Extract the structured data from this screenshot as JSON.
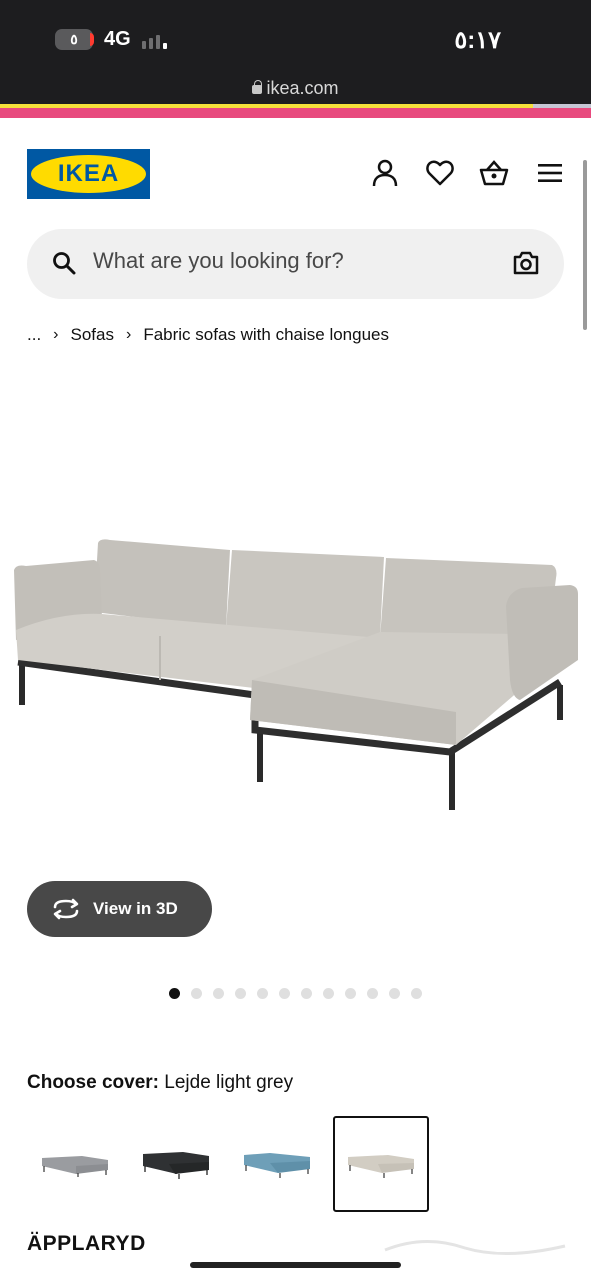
{
  "status_bar": {
    "battery_level": "٥",
    "network": "4G",
    "time": "٥:١٧"
  },
  "browser": {
    "url": "ikea.com"
  },
  "header": {
    "logo_text": "IKEA",
    "icons": [
      "user-icon",
      "heart-icon",
      "basket-icon",
      "menu-icon"
    ]
  },
  "search": {
    "placeholder": "What are you looking for?"
  },
  "breadcrumb": {
    "ellipsis": "...",
    "items": [
      "Sofas",
      "Fabric sofas with chaise longues"
    ]
  },
  "view_3d": {
    "label": "View in 3D"
  },
  "carousel": {
    "total": 12,
    "active_index": 0
  },
  "cover": {
    "label": "Choose cover:",
    "value": "Lejde light grey",
    "options": [
      {
        "color": "#9a9ca0"
      },
      {
        "color": "#2f3133"
      },
      {
        "color": "#6e9fb8"
      },
      {
        "color": "#d2cdc3",
        "selected": true
      }
    ]
  },
  "product": {
    "name": "ÄPPLARYD"
  },
  "colors": {
    "ikea_blue": "#0058a3",
    "ikea_yellow": "#ffdb00",
    "accent_pink": "#e84a7e"
  }
}
